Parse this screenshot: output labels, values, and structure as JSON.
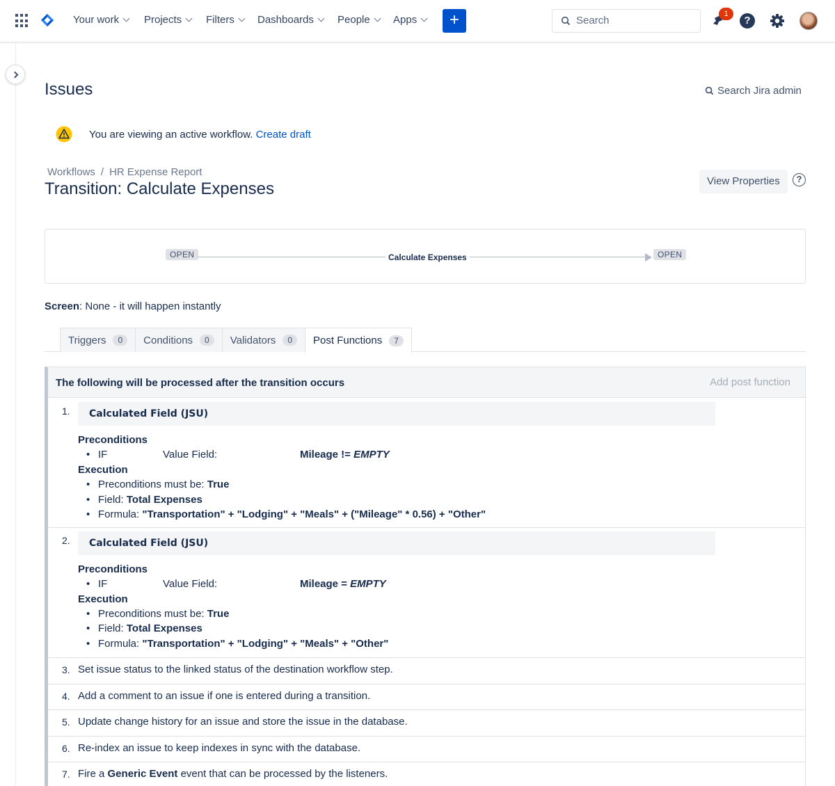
{
  "nav": {
    "items": [
      "Your work",
      "Projects",
      "Filters",
      "Dashboards",
      "People",
      "Apps"
    ],
    "create_label": "+",
    "search_placeholder": "Search",
    "notification_count": "1",
    "help_label": "?"
  },
  "page": {
    "title": "Issues",
    "admin_search": "Search Jira admin",
    "warning_text": "You are viewing an active workflow.",
    "warning_link": "Create draft",
    "breadcrumb_root": "Workflows",
    "breadcrumb_sep": "/",
    "breadcrumb_current": "HR Expense Report",
    "transition_title": "Transition: Calculate Expenses",
    "view_properties": "View Properties",
    "help_q": "?"
  },
  "diagram": {
    "from_status": "OPEN",
    "transition": "Calculate Expenses",
    "to_status": "OPEN"
  },
  "screen": {
    "label": "Screen",
    "value": ": None - it will happen instantly"
  },
  "tabs": [
    {
      "label": "Triggers",
      "count": "0"
    },
    {
      "label": "Conditions",
      "count": "0"
    },
    {
      "label": "Validators",
      "count": "0"
    },
    {
      "label": "Post Functions",
      "count": "7"
    }
  ],
  "post_functions": {
    "header": "The following will be processed after the transition occurs",
    "add_label": "Add post function",
    "items": [
      {
        "num": "1.",
        "title": "Calculated Field (JSU)",
        "preconditions_label": "Preconditions",
        "if_label": "IF",
        "value_field_label": "Value Field:",
        "condition_field": "Mileage != ",
        "condition_value": "EMPTY",
        "execution_label": "Execution",
        "must_be_label": "Preconditions must be: ",
        "must_be_value": "True",
        "field_label": "Field: ",
        "field_value": "Total Expenses",
        "formula_label": "Formula: ",
        "formula_value": "\"Transportation\" + \"Lodging\" + \"Meals\" + (\"Mileage\" * 0.56) + \"Other\""
      },
      {
        "num": "2.",
        "title": "Calculated Field (JSU)",
        "preconditions_label": "Preconditions",
        "if_label": "IF",
        "value_field_label": "Value Field:",
        "condition_field": "Mileage = ",
        "condition_value": "EMPTY",
        "execution_label": "Execution",
        "must_be_label": "Preconditions must be: ",
        "must_be_value": "True",
        "field_label": "Field: ",
        "field_value": "Total Expenses",
        "formula_label": "Formula: ",
        "formula_value": "\"Transportation\" + \"Lodging\" + \"Meals\" + \"Other\""
      }
    ],
    "simple": [
      {
        "num": "3.",
        "text": "Set issue status to the linked status of the destination workflow step."
      },
      {
        "num": "4.",
        "text": "Add a comment to an issue if one is entered during a transition."
      },
      {
        "num": "5.",
        "text": "Update change history for an issue and store the issue in the database."
      },
      {
        "num": "6.",
        "text": "Re-index an issue to keep indexes in sync with the database."
      }
    ],
    "last": {
      "num": "7.",
      "pre": "Fire a ",
      "bold": "Generic Event",
      "post": " event that can be processed by the listeners."
    }
  }
}
